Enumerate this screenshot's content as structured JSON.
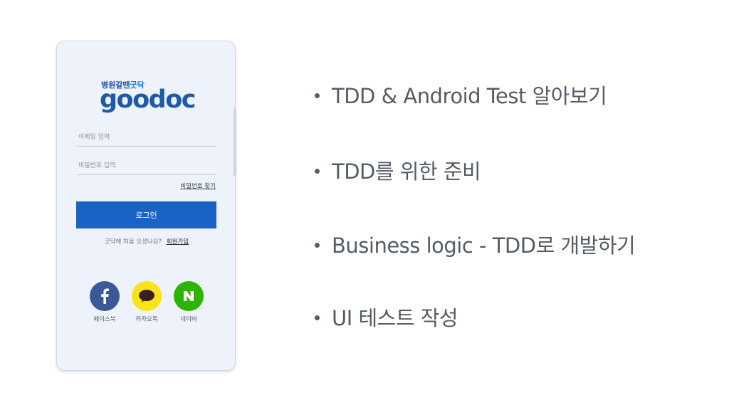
{
  "app": {
    "brand_sub": "병원갈땐",
    "brand_sub_accent": "굿닥",
    "logo": "goodoc"
  },
  "login": {
    "email_placeholder": "이메일 입력",
    "password_placeholder": "비밀번호 입력",
    "find_password": "비밀번호 찾기",
    "login_button": "로그인",
    "signup_prompt": "굿닥에 처음 오셨나요?",
    "signup_link": "회원가입"
  },
  "social": [
    {
      "label": "페이스북",
      "icon": "facebook-icon",
      "color": "#3b5998"
    },
    {
      "label": "카카오톡",
      "icon": "kakao-chat-icon",
      "color": "#f7e317"
    },
    {
      "label": "네이버",
      "icon": "naver-icon",
      "color": "#2db400"
    }
  ],
  "bullets": [
    "TDD & Android Test 알아보기",
    "TDD를 위한 준비",
    "Business logic - TDD로 개발하기",
    "UI 테스트 작성"
  ],
  "colors": {
    "primary": "#1a62c3",
    "logo": "#1f5aa8",
    "phone_bg": "#eef3fb",
    "bullet_text": "#555c66"
  }
}
